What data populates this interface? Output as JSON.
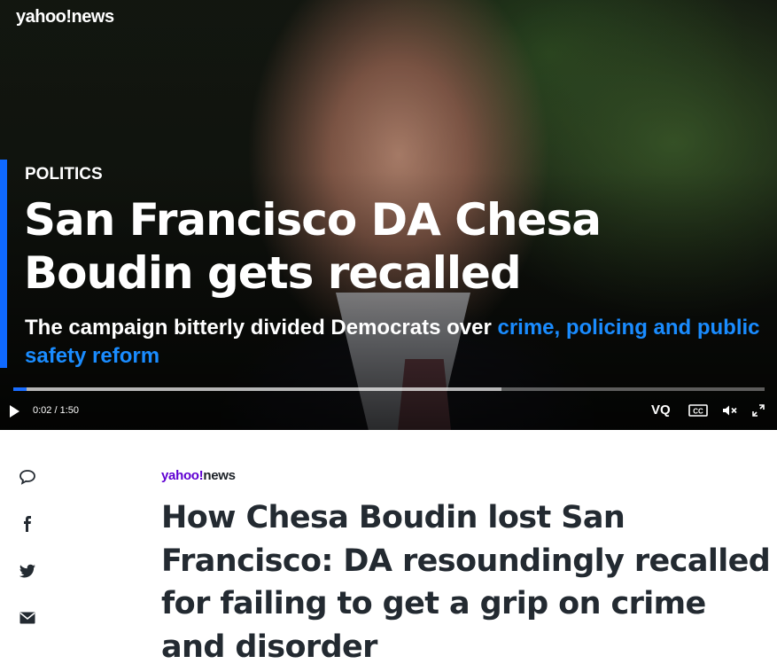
{
  "video": {
    "logo": "yahoo!news",
    "kicker": "POLITICS",
    "headline": "San Francisco DA Chesa Boudin gets recalled",
    "subhead_plain": "The campaign bitterly divided Democrats over ",
    "subhead_link": "crime, policing and public safety reform",
    "time": "0:02 / 1:50",
    "progress_fraction": 0.018,
    "buffer_fraction": 0.65,
    "vq_label": "VQ",
    "cc_label": "CC",
    "accent_color": "#0f69ff"
  },
  "share": {
    "icons": [
      "comment-icon",
      "facebook-icon",
      "twitter-icon",
      "mail-icon"
    ]
  },
  "article": {
    "source_logo_yahoo": "yahoo!",
    "source_logo_news": "news",
    "title": "How Chesa Boudin lost San Francisco: DA resoundingly recalled for failing to get a grip on crime and disorder"
  }
}
